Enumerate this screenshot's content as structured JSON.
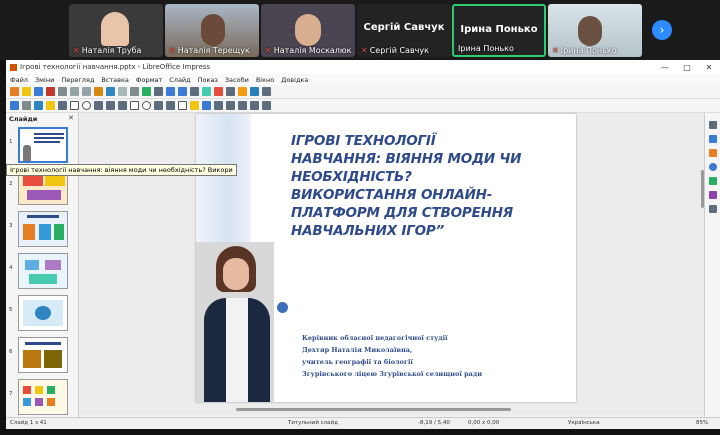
{
  "participants": [
    {
      "name": "Наталія Труба",
      "muted": true,
      "bg": "#3a3a3a"
    },
    {
      "name": "Наталія Терещук",
      "muted": true,
      "bg": "#7a6a5a"
    },
    {
      "name": "Наталія Москалюк",
      "muted": true,
      "bg": "#4a4450"
    },
    {
      "name": "Сергій Савчук",
      "muted": true,
      "bg": "#232323",
      "text_only": true
    },
    {
      "name": "Ірина Понько",
      "muted": false,
      "bg": "#232323",
      "text_only": true,
      "active": true
    },
    {
      "name": "Ірина Понько",
      "muted": true,
      "bg": "#c8d4d8"
    }
  ],
  "window": {
    "title": "Ігрові технології навчання.pptx - LibreOffice Impress"
  },
  "menu": [
    "Файл",
    "Зміни",
    "Перегляд",
    "Вставка",
    "Формат",
    "Слайд",
    "Показ",
    "Засоби",
    "Вікно",
    "Довідка"
  ],
  "panel": {
    "header": "Слайди",
    "tooltip": "Ігрові технології навчання: віяння моди чи необхідність? Викори",
    "thumb_numbers": [
      "1",
      "2",
      "3",
      "4",
      "5",
      "6",
      "7"
    ]
  },
  "slide": {
    "title_lines": [
      "ІГРОВІ ТЕХНОЛОГІЇ",
      "НАВЧАННЯ: ВІЯННЯ МОДИ ЧИ",
      "НЕОБХІДНІСТЬ?",
      "ВИКОРИСТАННЯ ОНЛАЙН-",
      "ПЛАТФОРМ ДЛЯ СТВОРЕННЯ",
      "НАВЧАЛЬНИХ ІГОР”"
    ],
    "info_lines": [
      "Керівник обласної педагогічної студії",
      "Дехтяр Наталія Миколаївна,",
      "учитель географії та біології",
      "Згурівського ліцею Згурівської селищної ради"
    ]
  },
  "status": {
    "slide": "Слайд 1 з 41",
    "layout": "Титульний слайд",
    "position": "-8,19 / 5,40",
    "size": "0,00 x 0,00",
    "lang": "Українська",
    "zoom": "85%"
  },
  "colors": {
    "accent": "#2e4a8b",
    "active_border": "#2ecc71",
    "zoom_blue": "#2d8cff"
  }
}
